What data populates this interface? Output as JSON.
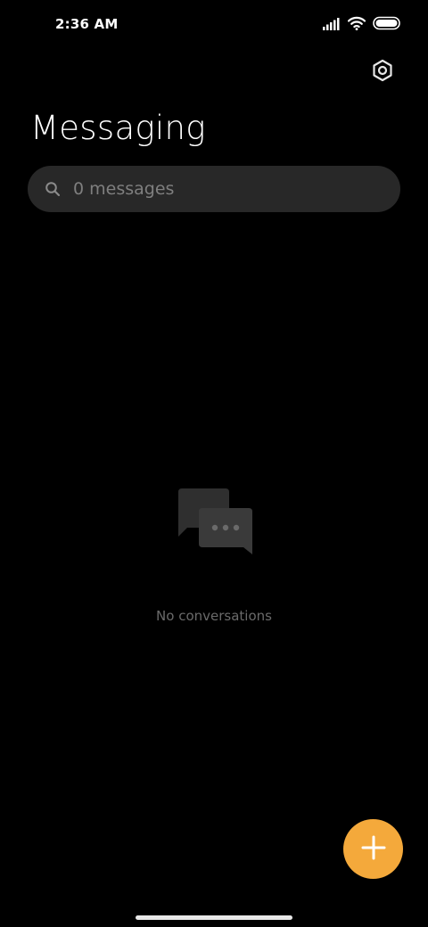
{
  "status_bar": {
    "time": "2:36 AM",
    "icons": [
      "signal-icon",
      "wifi-icon",
      "battery-icon"
    ]
  },
  "header": {
    "title": "Messaging",
    "settings_icon": "gear-icon"
  },
  "search": {
    "placeholder": "0 messages",
    "value": "",
    "icon": "search-icon"
  },
  "empty_state": {
    "icon": "chat-bubbles-icon",
    "text": "No conversations"
  },
  "fab": {
    "icon": "plus-icon",
    "color": "#f4a93b"
  },
  "colors": {
    "background": "#000000",
    "search_background": "#282828",
    "accent": "#f4a93b"
  }
}
